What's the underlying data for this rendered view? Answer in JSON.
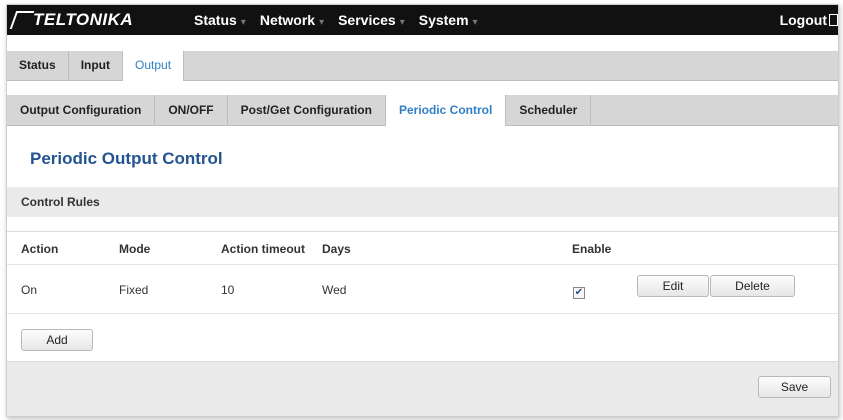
{
  "brand": {
    "name": "TELTONIKA"
  },
  "nav": {
    "items": [
      {
        "label": "Status",
        "caret": "▾"
      },
      {
        "label": "Network",
        "caret": "▾"
      },
      {
        "label": "Services",
        "caret": "▾"
      },
      {
        "label": "System",
        "caret": "▾"
      }
    ],
    "logout_label": "Logout"
  },
  "tabs_primary": [
    {
      "label": "Status",
      "active": false
    },
    {
      "label": "Input",
      "active": false
    },
    {
      "label": "Output",
      "active": true
    }
  ],
  "tabs_secondary": [
    {
      "label": "Output Configuration",
      "active": false
    },
    {
      "label": "ON/OFF",
      "active": false
    },
    {
      "label": "Post/Get Configuration",
      "active": false
    },
    {
      "label": "Periodic Control",
      "active": true
    },
    {
      "label": "Scheduler",
      "active": false
    }
  ],
  "page": {
    "title": "Periodic Output Control",
    "section_title": "Control Rules"
  },
  "table": {
    "columns": [
      "Action",
      "Mode",
      "Action timeout",
      "Days",
      "Enable"
    ],
    "rows": [
      {
        "action": "On",
        "mode": "Fixed",
        "timeout": "10",
        "days": "Wed",
        "enabled": true,
        "edit_label": "Edit",
        "delete_label": "Delete"
      }
    ]
  },
  "buttons": {
    "add_label": "Add",
    "save_label": "Save"
  },
  "colors": {
    "navbar_bg": "#111111",
    "accent": "#2f80c6",
    "title": "#24548f",
    "tab_bar_bg": "#d6d6d6",
    "section_bg": "#eaeaea"
  }
}
